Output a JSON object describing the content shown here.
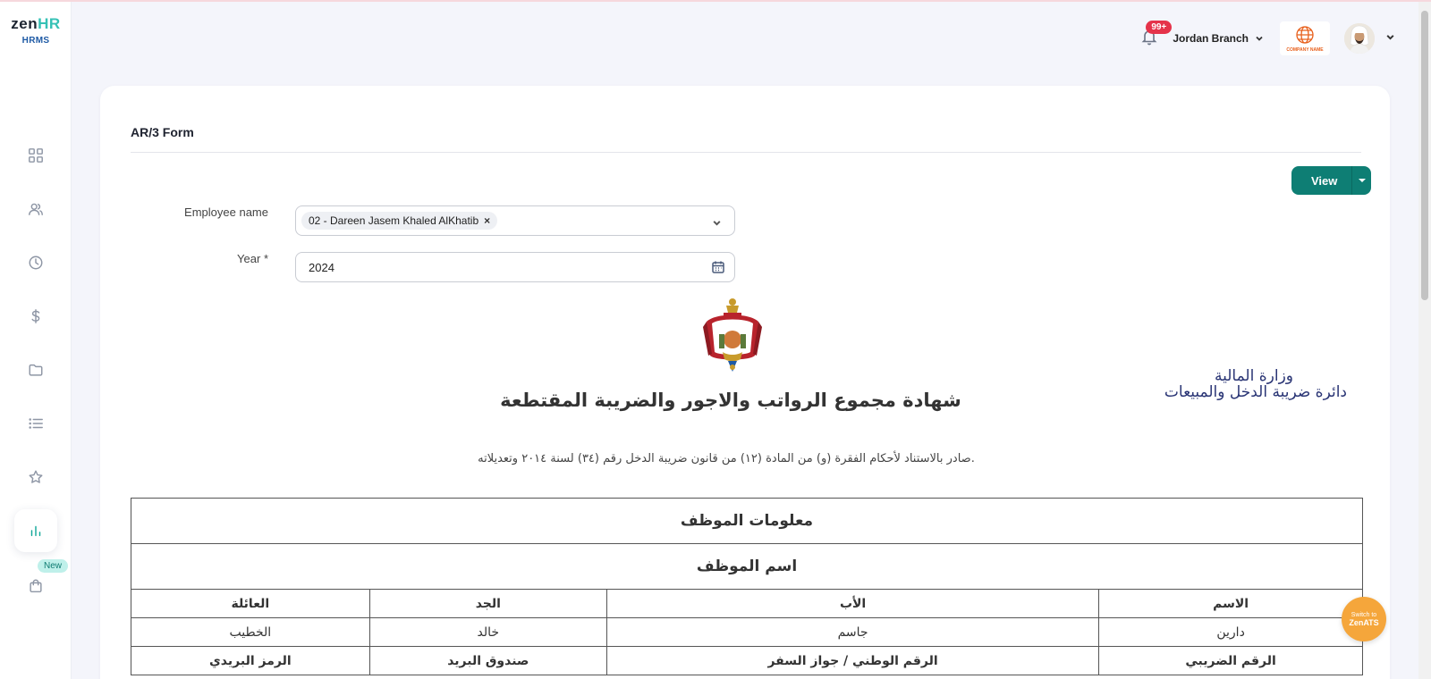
{
  "app": {
    "logo_text": "zen",
    "logo_accent": "HR",
    "logo_sub": "HRMS"
  },
  "sidebar": {
    "items": [
      {
        "name": "dashboard",
        "icon": "grid-icon",
        "active": false
      },
      {
        "name": "people",
        "icon": "users-icon",
        "active": false
      },
      {
        "name": "time",
        "icon": "clock-icon",
        "active": false
      },
      {
        "name": "payroll",
        "icon": "dollar-icon",
        "active": false
      },
      {
        "name": "documents",
        "icon": "folder-icon",
        "active": false
      },
      {
        "name": "lists",
        "icon": "list-icon",
        "active": false
      },
      {
        "name": "favorites",
        "icon": "star-icon",
        "active": false
      },
      {
        "name": "reports",
        "icon": "bar-chart-icon",
        "active": true
      },
      {
        "name": "store",
        "icon": "shopping-bag-icon",
        "active": false
      }
    ],
    "new_badge": "New"
  },
  "header": {
    "notification_count": "99+",
    "branch": "Jordan Branch",
    "company_logo_text": "COMPANY NAME"
  },
  "page": {
    "title": "AR/3 Form",
    "view_label": "View",
    "employee_label": "Employee name",
    "employee_value": "02 - Dareen Jasem Khaled AlKhatib",
    "chip_remove": "×",
    "year_label": "Year",
    "year_required": "*",
    "year_value": "2024"
  },
  "document": {
    "ministry_line1": "وزارة المالية",
    "ministry_line2": "دائرة ضريبة الدخل والمبيعات",
    "title": "شهادة مجموع الرواتب والاجور والضريبة المقتطعة",
    "subtitle": "صادر بالاستناد لأحكام الفقرة (و) من المادة (١٢) من قانون ضريبة الدخل رقم (٣٤) لسنة ٢٠١٤ وتعديلاته.",
    "section_employee_info": "معلومات الموظف",
    "section_employee_name": "اسم الموظف",
    "name_headers": [
      "الاسم",
      "الأب",
      "الجد",
      "العائلة"
    ],
    "name_values": [
      "دارين",
      "جاسم",
      "خالد",
      "الخطيب"
    ],
    "id_headers": [
      "الرقم الضريبي",
      "الرقم الوطني / جواز السفر",
      "صندوق البريد",
      "الرمز البريدي"
    ]
  },
  "switch_ats": {
    "line1": "Switch to",
    "line2": "ZenATS"
  },
  "colors": {
    "accent": "#0e7e74",
    "sidebar_active": "#14a89a",
    "badge": "#e5334a",
    "ats": "#f5a63b"
  }
}
